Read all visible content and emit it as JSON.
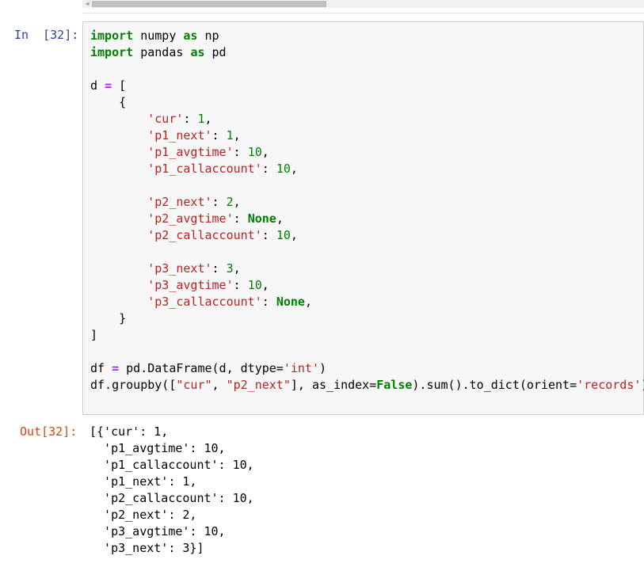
{
  "in_prompt": "In  [32]:",
  "out_prompt": "Out[32]:",
  "code": {
    "import": "import",
    "as": "as",
    "numpy": " numpy ",
    "np": " np",
    "pandas": " pandas ",
    "pd": " pd",
    "d_assign": "d ",
    "eq": "=",
    "open_bracket": " [",
    "open_brace": "    {",
    "close_brace": "    }",
    "close_bracket": "]",
    "colon_sp": ": ",
    "comma": ",",
    "k_cur": "'cur'",
    "k_p1_next": "'p1_next'",
    "k_p1_avgtime": "'p1_avgtime'",
    "k_p1_callaccount": "'p1_callaccount'",
    "k_p2_next": "'p2_next'",
    "k_p2_avgtime": "'p2_avgtime'",
    "k_p2_callaccount": "'p2_callaccount'",
    "k_p3_next": "'p3_next'",
    "k_p3_avgtime": "'p3_avgtime'",
    "k_p3_callaccount": "'p3_callaccount'",
    "v1": "1",
    "v2": "2",
    "v3": "3",
    "v10": "10",
    "none": "None",
    "df_assign": "df ",
    "df_rhs": " pd.DataFrame(d, dtype=",
    "s_int": "'int'",
    "close_paren": ")",
    "groupby_a": "df.groupby([",
    "s_cur": "\"cur\"",
    "sep": ", ",
    "s_p2next": "\"p2_next\"",
    "groupby_b": "], as_index=",
    "false": "False",
    "groupby_c": ").sum().to_dict(orient=",
    "s_records": "'records'"
  },
  "output_lines": [
    "[{'cur': 1,",
    "  'p1_avgtime': 10,",
    "  'p1_callaccount': 10,",
    "  'p1_next': 1,",
    "  'p2_callaccount': 10,",
    "  'p2_next': 2,",
    "  'p3_avgtime': 10,",
    "  'p3_next': 3}]"
  ]
}
